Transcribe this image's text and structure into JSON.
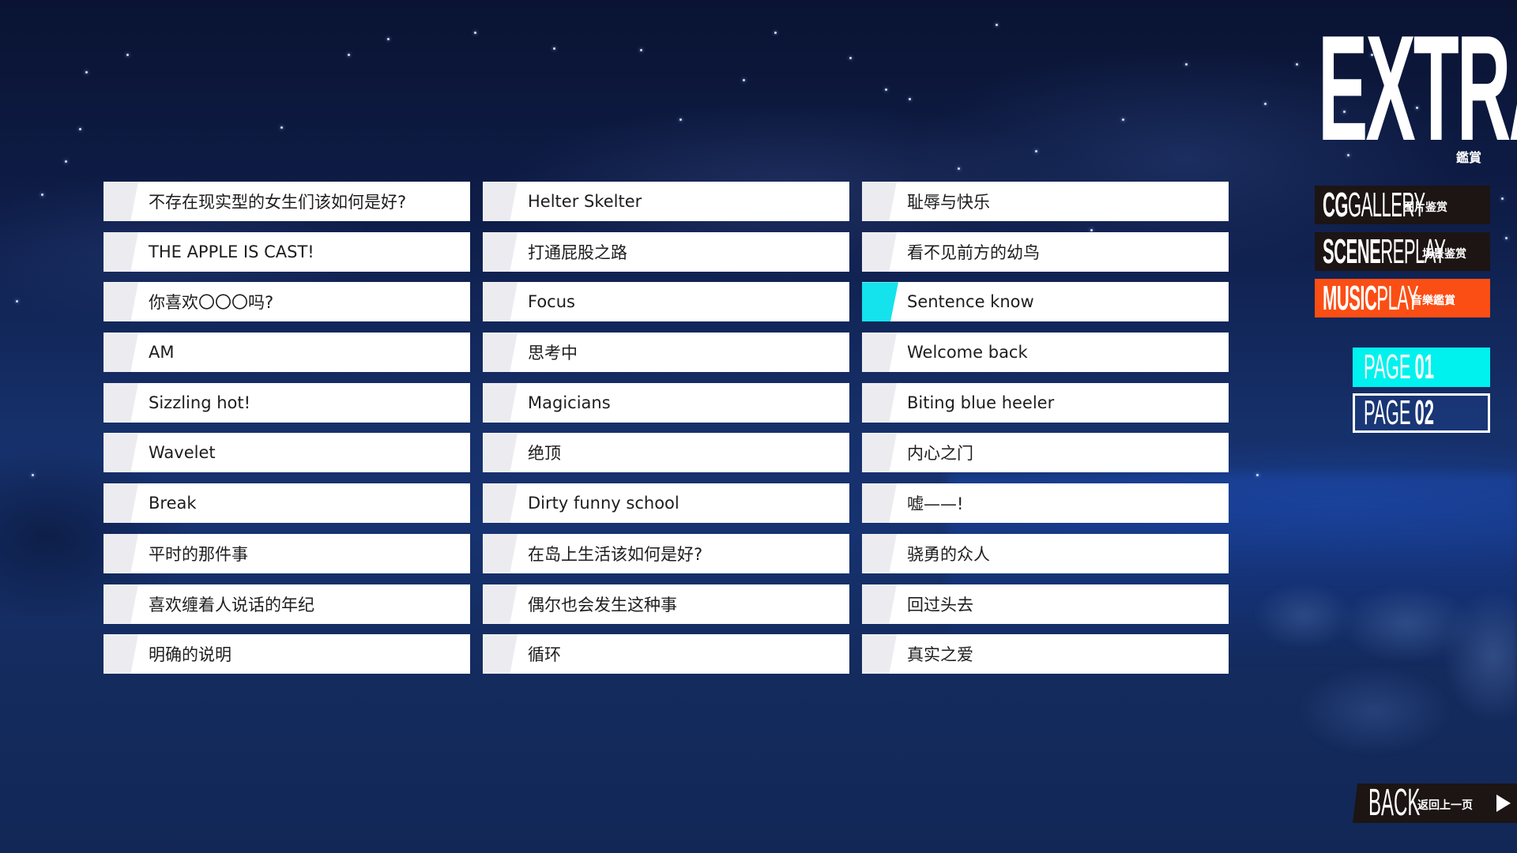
{
  "header": {
    "title": "EXTRA",
    "subtitle": "鑑賞"
  },
  "menu": [
    {
      "bold": "CG",
      "light": "GALLERY",
      "cn": "图片鉴赏",
      "active": false
    },
    {
      "bold": "SCENE",
      "light": "REPLAY",
      "cn": "场景鉴赏",
      "active": false
    },
    {
      "bold": "MUSIC",
      "light": "PLAY",
      "cn": "音樂鑑賞",
      "active": true
    }
  ],
  "pages": [
    {
      "prefix": "PAGE",
      "num": "01",
      "active": true
    },
    {
      "prefix": "PAGE",
      "num": "02",
      "active": false
    }
  ],
  "back": {
    "label": "BACK",
    "cn": "返回上一页"
  },
  "colors": {
    "accent_cyan": "#14e2ec",
    "page_active": "#00f2ee",
    "menu_active": "#fb4e14",
    "menu_dark": "#1c1514"
  },
  "songs": {
    "columns": [
      [
        "不存在现实型的女生们该如何是好?",
        "THE APPLE IS CAST!",
        "你喜欢〇〇〇吗?",
        "AM",
        "Sizzling hot!",
        "Wavelet",
        "Break",
        "平时的那件事",
        "喜欢缠着人说话的年纪",
        "明确的说明"
      ],
      [
        "Helter Skelter",
        "打通屁股之路",
        "Focus",
        "思考中",
        "Magicians",
        "绝顶",
        "Dirty funny school",
        "在岛上生活该如何是好?",
        "偶尔也会发生这种事",
        "循环"
      ],
      [
        "耻辱与快乐",
        "看不见前方的幼鸟",
        "Sentence know",
        "Welcome back",
        "Biting blue heeler",
        "内心之门",
        "嘘——!",
        "骁勇的众人",
        "回过头去",
        "真实之爱"
      ]
    ],
    "selected": {
      "column": 2,
      "row": 2
    }
  }
}
